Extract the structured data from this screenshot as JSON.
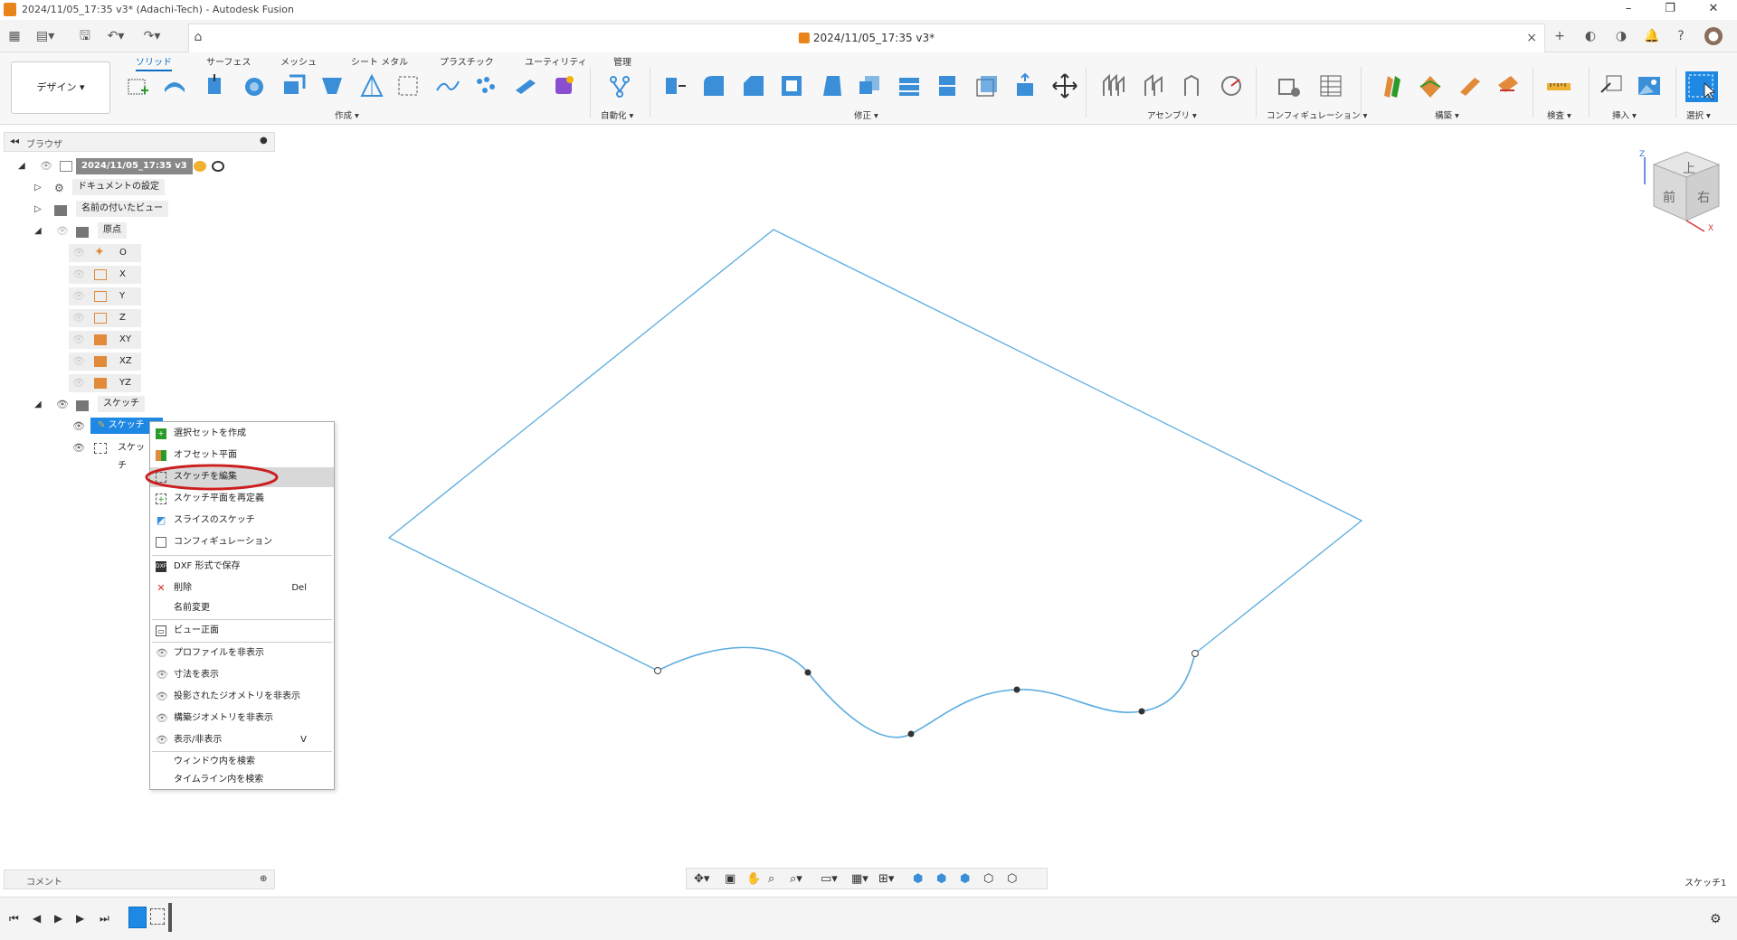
{
  "window": {
    "title": "2024/11/05_17:35 v3* (Adachi-Tech) - Autodesk Fusion",
    "minimize": "–",
    "restore": "❐",
    "close": "✕"
  },
  "document": {
    "tab_title": "2024/11/05_17:35 v3*",
    "close": "×"
  },
  "ribbon": {
    "workspace": "デザイン ▾",
    "tabs": [
      "ソリッド",
      "サーフェス",
      "メッシュ",
      "シート メタル",
      "プラスチック",
      "ユーティリティ",
      "管理"
    ],
    "groups": [
      "作成 ▾",
      "自動化 ▾",
      "修正 ▾",
      "アセンブリ ▾",
      "コンフィギュレーション ▾",
      "構築 ▾",
      "検査 ▾",
      "挿入 ▾",
      "選択 ▾"
    ]
  },
  "browser": {
    "title": "ブラウザ",
    "root": "2024/11/05_17:35 v3",
    "items": {
      "doc_settings": "ドキュメントの設定",
      "named_views": "名前の付いたビュー",
      "origin": "原点",
      "o": "O",
      "x": "X",
      "y": "Y",
      "z": "Z",
      "xy": "XY",
      "xz": "XZ",
      "yz": "YZ",
      "sketches": "スケッチ",
      "sketch1": "スケッチ",
      "sketch2": "スケッチ"
    }
  },
  "context_menu": {
    "items": [
      {
        "label": "選択セットを作成",
        "icon": "selection-set-icon"
      },
      {
        "label": "オフセット平面",
        "icon": "offset-plane-icon"
      },
      {
        "label": "スケッチを編集",
        "icon": "edit-sketch-icon"
      },
      {
        "label": "スケッチ平面を再定義",
        "icon": "redefine-plane-icon"
      },
      {
        "label": "スライスのスケッチ",
        "icon": "slice-icon"
      },
      {
        "label": "コンフィギュレーション",
        "icon": "config-icon"
      },
      {
        "label": "DXF 形式で保存",
        "icon": "dxf-icon"
      },
      {
        "label": "削除",
        "icon": "delete-icon",
        "shortcut": "Del"
      },
      {
        "label": "名前変更",
        "icon": ""
      },
      {
        "label": "ビュー正面",
        "icon": "look-at-icon"
      },
      {
        "label": "プロファイルを非表示",
        "icon": "eye-icon"
      },
      {
        "label": "寸法を表示",
        "icon": "eye-icon"
      },
      {
        "label": "投影されたジオメトリを非表示",
        "icon": "eye-icon"
      },
      {
        "label": "構築ジオメトリを非表示",
        "icon": "eye-icon"
      },
      {
        "label": "表示/非表示",
        "icon": "eye-icon",
        "shortcut": "V"
      },
      {
        "label": "ウィンドウ内を検索",
        "icon": ""
      },
      {
        "label": "タイムライン内を検索",
        "icon": ""
      }
    ]
  },
  "viewcube": {
    "top": "上",
    "front": "前",
    "right": "右",
    "x": "X",
    "z": "Z"
  },
  "comment": {
    "title": "コメント"
  },
  "status": {
    "right": "スケッチ1"
  },
  "colors": {
    "accent": "#0a6fc2",
    "sketch_line": "#5aace0",
    "highlight_ring": "#cc1f1f"
  }
}
